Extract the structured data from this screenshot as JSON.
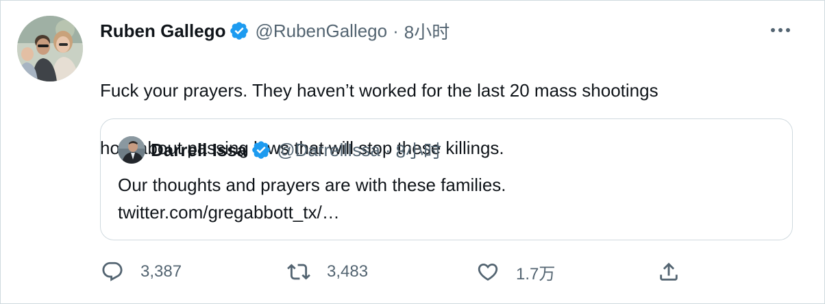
{
  "tweet": {
    "author_name": "Ruben Gallego",
    "author_handle": "@RubenGallego",
    "separator": "·",
    "time": "8小时",
    "text_line1": "Fuck your prayers.  They haven’t worked for the last 20 mass shootings",
    "text_line2": "how about passing laws that will stop these killings."
  },
  "quoted_tweet": {
    "author_name": "Darrell Issa",
    "author_handle": "@DarrellIssa",
    "separator": "·",
    "time": "8小时",
    "text": "Our thoughts and prayers are with these families.",
    "link": "twitter.com/gregabbott_tx/…"
  },
  "actions": {
    "reply_count": "3,387",
    "retweet_count": "3,483",
    "like_count": "1.7万"
  },
  "icons": {
    "verified": "verified-badge-icon",
    "more": "more-options-icon",
    "reply": "reply-icon",
    "retweet": "retweet-icon",
    "like": "heart-icon",
    "share": "share-icon"
  },
  "colors": {
    "verified_blue": "#1d9bf0",
    "text_primary": "#0f1419",
    "text_secondary": "#536471",
    "border": "#cfd9de"
  }
}
